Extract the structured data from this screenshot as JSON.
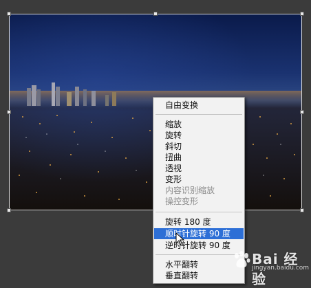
{
  "canvas": {
    "image_description_icon": "city-night-photo"
  },
  "context_menu": {
    "items": [
      {
        "label": "自由变换",
        "state": "normal"
      },
      {
        "label": "缩放",
        "state": "normal"
      },
      {
        "label": "旋转",
        "state": "normal"
      },
      {
        "label": "斜切",
        "state": "normal"
      },
      {
        "label": "扭曲",
        "state": "normal"
      },
      {
        "label": "透视",
        "state": "normal"
      },
      {
        "label": "变形",
        "state": "normal"
      },
      {
        "label": "内容识别缩放",
        "state": "disabled"
      },
      {
        "label": "操控变形",
        "state": "disabled"
      },
      {
        "label": "旋转 180 度",
        "state": "normal"
      },
      {
        "label": "顺时针旋转 90 度",
        "state": "highlighted"
      },
      {
        "label": "逆时针旋转 90 度",
        "state": "normal"
      },
      {
        "label": "水平翻转",
        "state": "normal"
      },
      {
        "label": "垂直翻转",
        "state": "normal"
      }
    ]
  },
  "watermark": {
    "text": "Bai 经验",
    "url": "jingyan.baidu.com"
  },
  "colors": {
    "highlight": "#2d6fd6",
    "menu_bg": "#f2f2f2",
    "workspace_bg": "#3b3b3b"
  }
}
